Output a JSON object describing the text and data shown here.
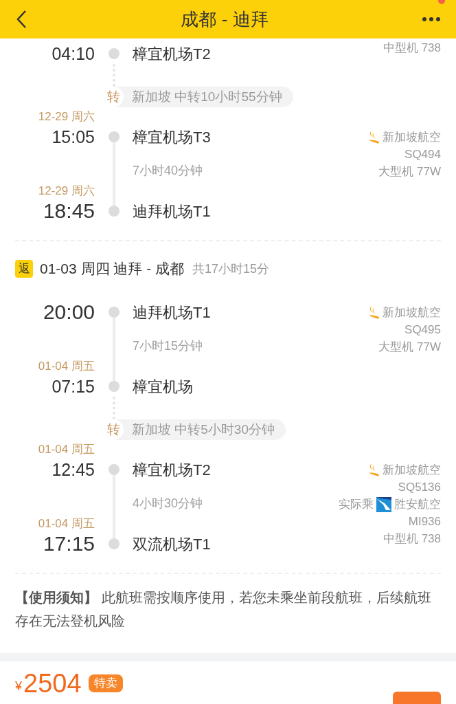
{
  "header": {
    "title": "成都 - 迪拜",
    "notification": true
  },
  "timeline": [
    {
      "kind": "stop",
      "time": "04:10",
      "large": false,
      "airport": "樟宜机场T2",
      "info": [
        {
          "kind": "text",
          "text": "中型机 738"
        }
      ]
    },
    {
      "kind": "transfer",
      "label": "转",
      "text": "新加坡 中转10小时55分钟"
    },
    {
      "kind": "leg",
      "departure": {
        "date": "12-29 周六",
        "time": "15:05",
        "large": false,
        "airport": "樟宜机场T3"
      },
      "duration": "7小时40分钟",
      "arrival": {
        "date": "12-29 周六",
        "time": "18:45",
        "large": true,
        "airport": "迪拜机场T1"
      },
      "info": [
        {
          "kind": "airline",
          "text": "新加坡航空"
        },
        {
          "kind": "text",
          "text": "SQ494"
        },
        {
          "kind": "text",
          "text": "大型机 77W"
        }
      ]
    },
    {
      "kind": "divider"
    },
    {
      "kind": "journey",
      "badge": "返",
      "text": "01-03 周四 迪拜 - 成都",
      "total": "共17小时15分"
    },
    {
      "kind": "leg",
      "departure": {
        "time": "20:00",
        "large": true,
        "airport": "迪拜机场T1"
      },
      "duration": "7小时15分钟",
      "arrival": {
        "date": "01-04 周五",
        "time": "07:15",
        "large": false,
        "airport": "樟宜机场"
      },
      "info": [
        {
          "kind": "airline",
          "text": "新加坡航空"
        },
        {
          "kind": "text",
          "text": "SQ495"
        },
        {
          "kind": "text",
          "text": "大型机 77W"
        }
      ]
    },
    {
      "kind": "transfer",
      "label": "转",
      "text": "新加坡 中转5小时30分钟"
    },
    {
      "kind": "leg",
      "departure": {
        "date": "01-04 周五",
        "time": "12:45",
        "large": false,
        "airport": "樟宜机场T2"
      },
      "duration": "4小时30分钟",
      "arrival": {
        "date": "01-04 周五",
        "time": "17:15",
        "large": true,
        "airport": "双流机场T1"
      },
      "info": [
        {
          "kind": "airline",
          "text": "新加坡航空"
        },
        {
          "kind": "text",
          "text": "SQ5136"
        },
        {
          "kind": "operated",
          "prefix": "实际乘",
          "text": "胜安航空"
        },
        {
          "kind": "text",
          "text": "MI936"
        },
        {
          "kind": "text",
          "text": "中型机 738"
        }
      ]
    },
    {
      "kind": "divider"
    }
  ],
  "notice": "**【使用须知】** 此航班需按顺序使用，若您未乘坐前段航班，后续航班存在无法登机风险",
  "price": {
    "currency": "¥",
    "amount": "2504",
    "badge": "特卖"
  }
}
